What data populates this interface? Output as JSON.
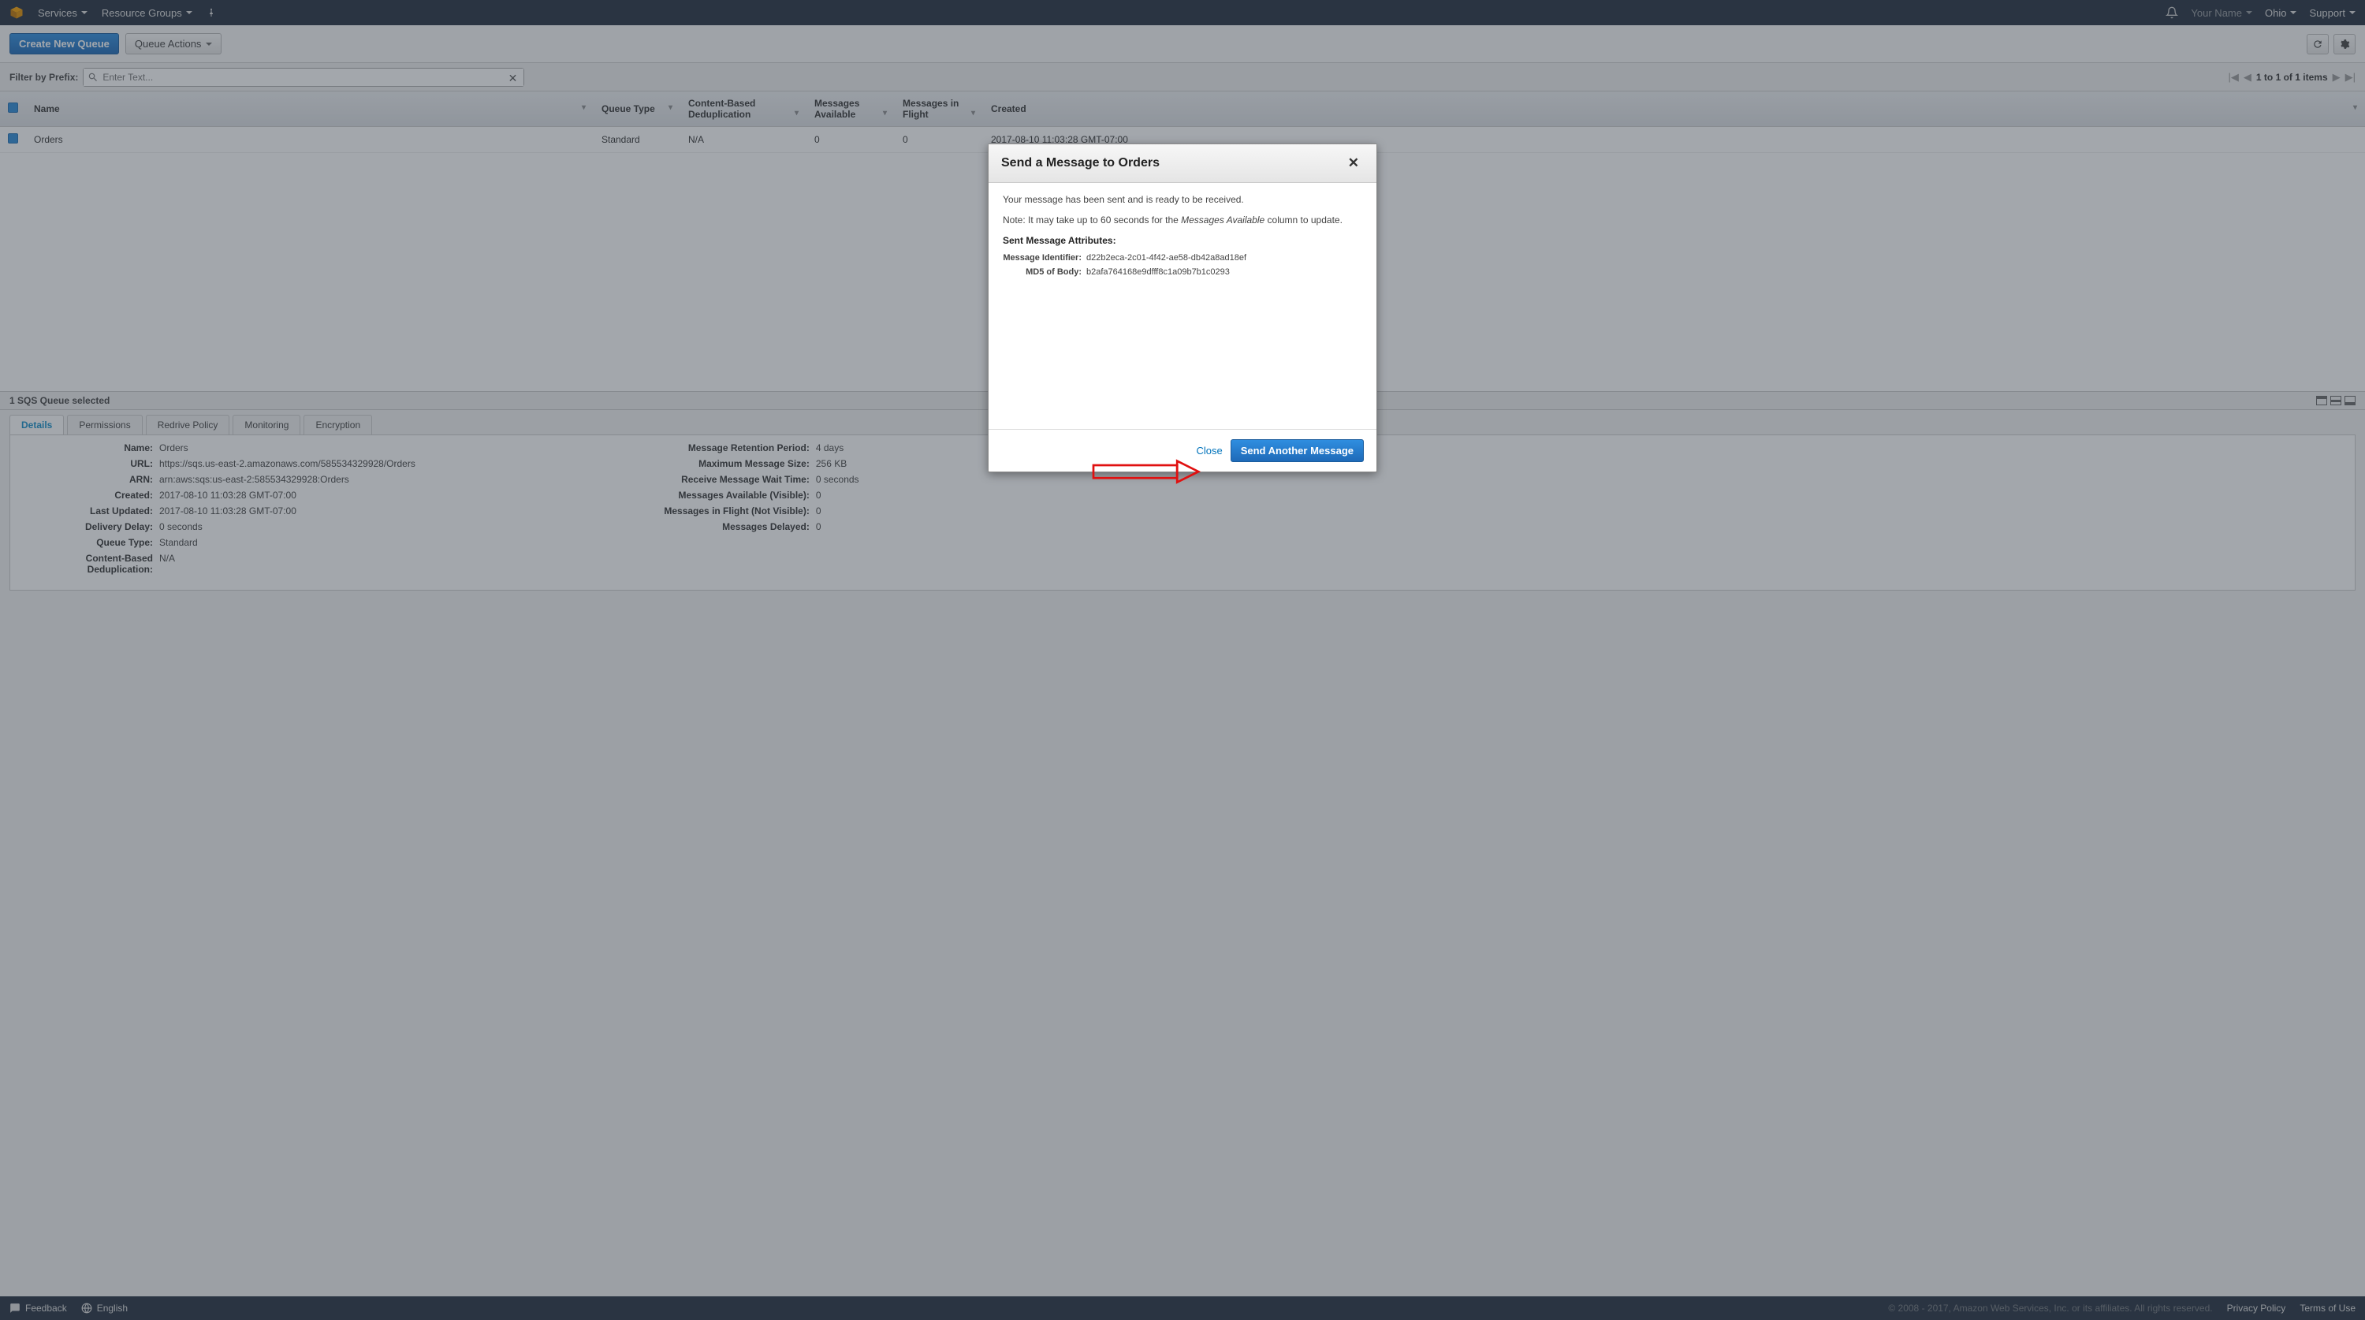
{
  "navbar": {
    "services": "Services",
    "resource_groups": "Resource Groups",
    "your_name": "Your Name",
    "region": "Ohio",
    "support": "Support"
  },
  "toolbar": {
    "create_label": "Create New Queue",
    "actions_label": "Queue Actions"
  },
  "filter": {
    "label": "Filter by Prefix:",
    "placeholder": "Enter Text..."
  },
  "pagination": {
    "text": "1 to 1 of 1 items"
  },
  "table": {
    "cols": {
      "name": "Name",
      "type": "Queue Type",
      "dedup": "Content-Based Deduplication",
      "avail": "Messages Available",
      "flight": "Messages in Flight",
      "created": "Created"
    },
    "rows": [
      {
        "name": "Orders",
        "type": "Standard",
        "dedup": "N/A",
        "avail": "0",
        "flight": "0",
        "created": "2017-08-10 11:03:28 GMT-07:00"
      }
    ]
  },
  "status_bar": "1 SQS Queue selected",
  "tabs": {
    "details": "Details",
    "permissions": "Permissions",
    "redrive": "Redrive Policy",
    "monitoring": "Monitoring",
    "encryption": "Encryption"
  },
  "details": {
    "left": {
      "name_l": "Name:",
      "name_v": "Orders",
      "url_l": "URL:",
      "url_v": "https://sqs.us-east-2.amazonaws.com/585534329928/Orders",
      "arn_l": "ARN:",
      "arn_v": "arn:aws:sqs:us-east-2:585534329928:Orders",
      "created_l": "Created:",
      "created_v": "2017-08-10 11:03:28 GMT-07:00",
      "updated_l": "Last Updated:",
      "updated_v": "2017-08-10 11:03:28 GMT-07:00",
      "delay_l": "Delivery Delay:",
      "delay_v": "0 seconds",
      "qtype_l": "Queue Type:",
      "qtype_v": "Standard",
      "dedup_l": "Content-Based Deduplication:",
      "dedup_v": "N/A"
    },
    "right": {
      "retention_l": "Message Retention Period:",
      "retention_v": "4 days",
      "maxsize_l": "Maximum Message Size:",
      "maxsize_v": "256 KB",
      "recvwait_l": "Receive Message Wait Time:",
      "recvwait_v": "0 seconds",
      "availvis_l": "Messages Available (Visible):",
      "availvis_v": "0",
      "flightnv_l": "Messages in Flight (Not Visible):",
      "flightnv_v": "0",
      "delayed_l": "Messages Delayed:",
      "delayed_v": "0"
    }
  },
  "modal": {
    "title": "Send a Message to Orders",
    "sent": "Your message has been sent and is ready to be received.",
    "note_prefix": "Note: It may take up to 60 seconds for the ",
    "note_em": "Messages Available",
    "note_suffix": " column to update.",
    "attr_header": "Sent Message Attributes:",
    "id_label": "Message Identifier:",
    "id_value": "d22b2eca-2c01-4f42-ae58-db42a8ad18ef",
    "md5_label": "MD5 of Body:",
    "md5_value": "b2afa764168e9dfff8c1a09b7b1c0293",
    "close": "Close",
    "send_another": "Send Another Message"
  },
  "footer": {
    "feedback": "Feedback",
    "language": "English",
    "copyright": "© 2008 - 2017, Amazon Web Services, Inc. or its affiliates. All rights reserved.",
    "privacy": "Privacy Policy",
    "terms": "Terms of Use"
  }
}
